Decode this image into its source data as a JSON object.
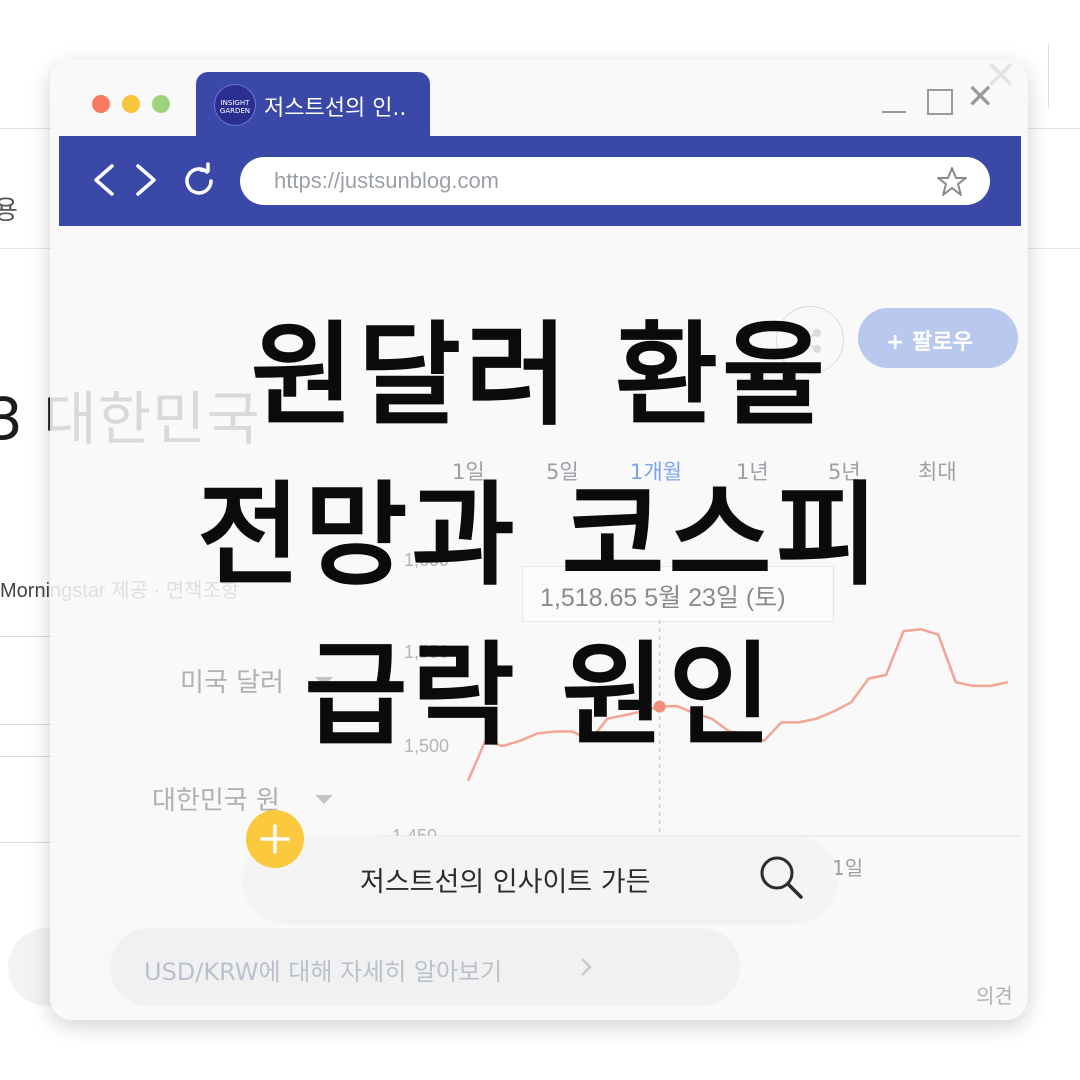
{
  "background": {
    "nav_fragment": "용",
    "title": "3 대한민국",
    "source": "Morningstar 제공 · 면책조항",
    "select_from": "미국 달러",
    "select_to": "대한민국 원",
    "learn_more": "USD/KRW에 대해 자세히 알아보기",
    "opinion": "의견"
  },
  "window": {
    "tab_title": "저스트선의 인..",
    "tab_logo_text": "INSIGHT GARDEN",
    "url": "https://justsunblog.com",
    "follow_label": "+ 팔로우",
    "ranges": [
      "1일",
      "5일",
      "1개월",
      "1년",
      "5년",
      "최대"
    ],
    "active_range": "1개월"
  },
  "chart_data": {
    "type": "line",
    "y_ticks": [
      "1,600",
      "1,550",
      "1,500",
      "1,450"
    ],
    "ylim": [
      1450,
      1600
    ],
    "x_tick": "1일",
    "tooltip": "1,518.65  5월 23일 (토)",
    "values": [
      1478,
      1500,
      1497,
      1500,
      1504,
      1505,
      1505,
      1500,
      1512,
      1514,
      1516,
      1518.65,
      1519,
      1515,
      1512,
      1505,
      1504,
      1500,
      1510,
      1510,
      1512,
      1516,
      1521,
      1534,
      1536,
      1560,
      1561,
      1558,
      1532,
      1530,
      1530,
      1532
    ],
    "line_color": "#f2a595"
  },
  "headline": {
    "line1": "원달러 환율",
    "line2": "전망과 코스피",
    "line3": "급락 원인"
  },
  "search": {
    "text": "저스트선의 인사이트 가든"
  }
}
